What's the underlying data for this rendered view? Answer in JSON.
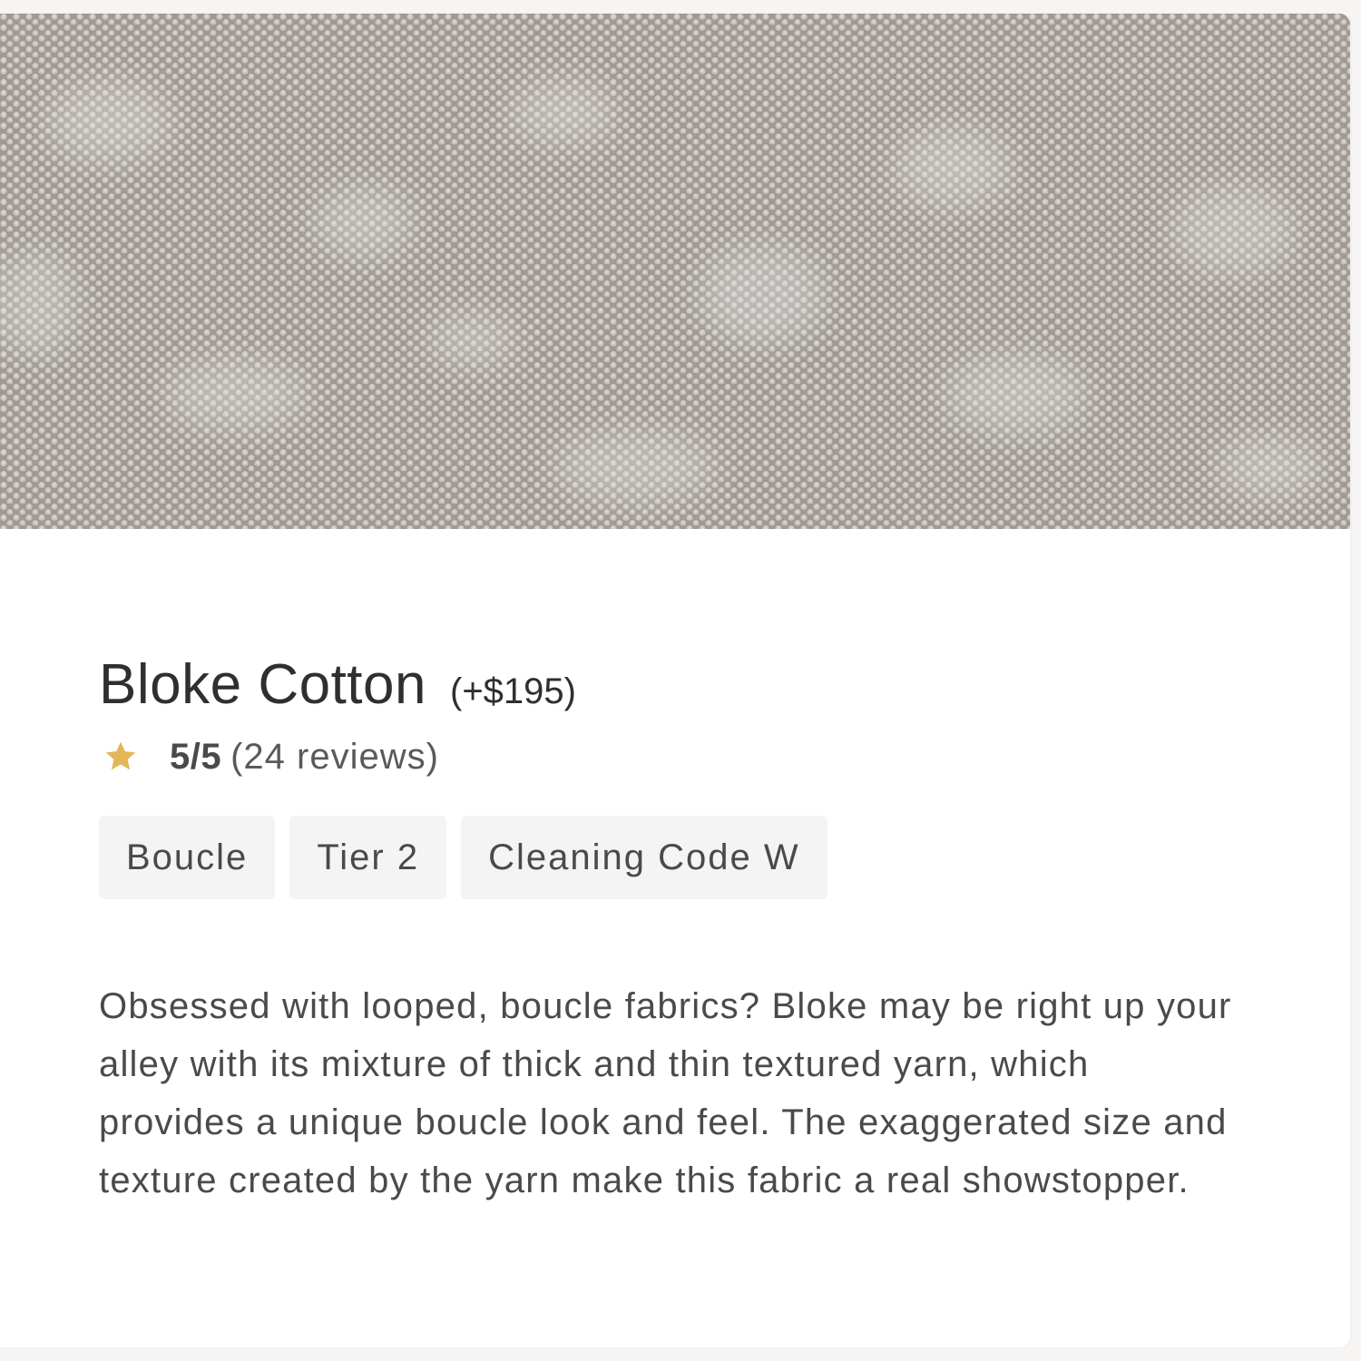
{
  "colors": {
    "page_bg": "#f7f5f3",
    "card_bg": "#ffffff",
    "text_primary": "#2f2f2f",
    "text_secondary": "#4a4a4a",
    "tag_bg": "#f4f4f4",
    "star": "#e2b857",
    "fabric_base": "#a8a29e"
  },
  "swatch": {
    "image": "fabric-swatch"
  },
  "product": {
    "name": "Bloke Cotton",
    "price_delta": "(+$195)"
  },
  "rating": {
    "icon": "star-icon",
    "score": "5/5",
    "count": "(24 reviews)"
  },
  "tags": [
    "Boucle",
    "Tier 2",
    "Cleaning Code W"
  ],
  "description": "Obsessed with looped, boucle fabrics? Bloke may be right up your alley with its mixture of thick and thin textured yarn, which provides a unique boucle look and feel. The exaggerated size and texture created by the yarn make this fabric a real showstopper."
}
